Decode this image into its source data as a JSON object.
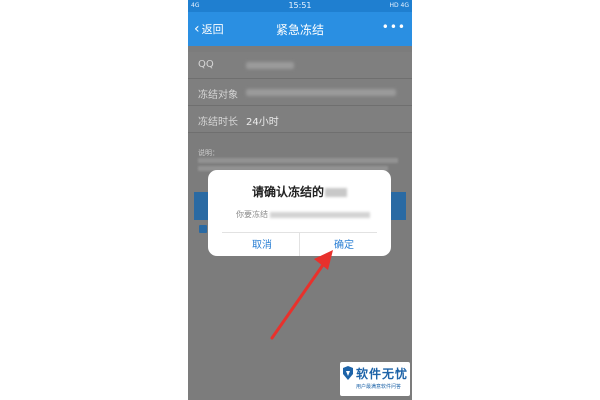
{
  "status_bar": {
    "network_left": "4G",
    "time": "15:51",
    "indicators_right": "HD 4G"
  },
  "header": {
    "back_label": "返回",
    "title": "紧急冻结",
    "more_icon": "ellipsis-icon"
  },
  "form": {
    "rows": [
      {
        "label": "QQ",
        "value": ""
      },
      {
        "label": "冻结对象",
        "value": ""
      },
      {
        "label": "冻结时长",
        "value": "24小时"
      }
    ],
    "note_label": "说明："
  },
  "dialog": {
    "title": "请确认冻结的",
    "message": "你要冻结",
    "cancel_label": "取消",
    "confirm_label": "确定"
  },
  "annotation": {
    "arrow_color": "#e8312c"
  },
  "watermark": {
    "name": "软件无忧",
    "subtitle": "用户最满意软件问答"
  },
  "colors": {
    "accent": "#2a8fe2",
    "dialog_button": "#2a7fd4"
  }
}
